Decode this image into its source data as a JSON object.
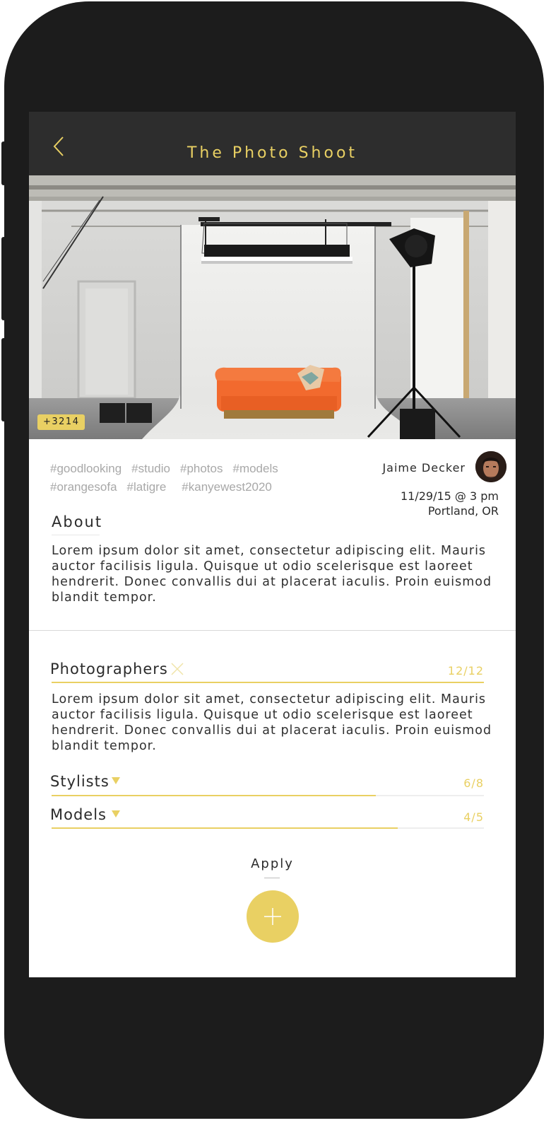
{
  "header": {
    "title": "The Photo Shoot",
    "back_icon": "chevron-left-icon"
  },
  "hero": {
    "count_badge": "+3214"
  },
  "tags": [
    "#goodlooking",
    "#studio",
    "#photos",
    "#models",
    "#orangesofa",
    "#latigre",
    "#kanyewest2020"
  ],
  "host": {
    "name": "Jaime Decker",
    "date": "11/29/15 @ 3 pm",
    "location": "Portland, OR"
  },
  "about": {
    "title": "About",
    "text": "Lorem ipsum dolor sit amet, consectetur adipiscing elit. Mauris auctor facilisis ligula. Quisque ut odio scelerisque est laoreet hendrerit. Donec convallis dui at placerat iaculis. Proin euismod blandit tempor."
  },
  "roles": [
    {
      "title": "Photographers",
      "count": "12/12",
      "filled": 12,
      "total": 12,
      "expanded": true,
      "toggle_icon": "close-icon",
      "text": "Lorem ipsum dolor sit amet, consectetur adipiscing elit. Mauris auctor facilisis ligula. Quisque ut odio scelerisque est laoreet hendrerit. Donec convallis dui at placerat iaculis. Proin euismod blandit tempor."
    },
    {
      "title": "Stylists",
      "count": "6/8",
      "filled": 6,
      "total": 8,
      "expanded": false,
      "toggle_icon": "caret-down-icon"
    },
    {
      "title": "Models",
      "count": "4/5",
      "filled": 4,
      "total": 5,
      "expanded": false,
      "toggle_icon": "caret-down-icon"
    }
  ],
  "apply": {
    "label": "Apply",
    "icon": "plus-icon"
  },
  "colors": {
    "accent": "#e9d063",
    "header_bg": "#2d2d2d",
    "frame": "#1c1c1c",
    "sofa": "#f26a2e"
  }
}
